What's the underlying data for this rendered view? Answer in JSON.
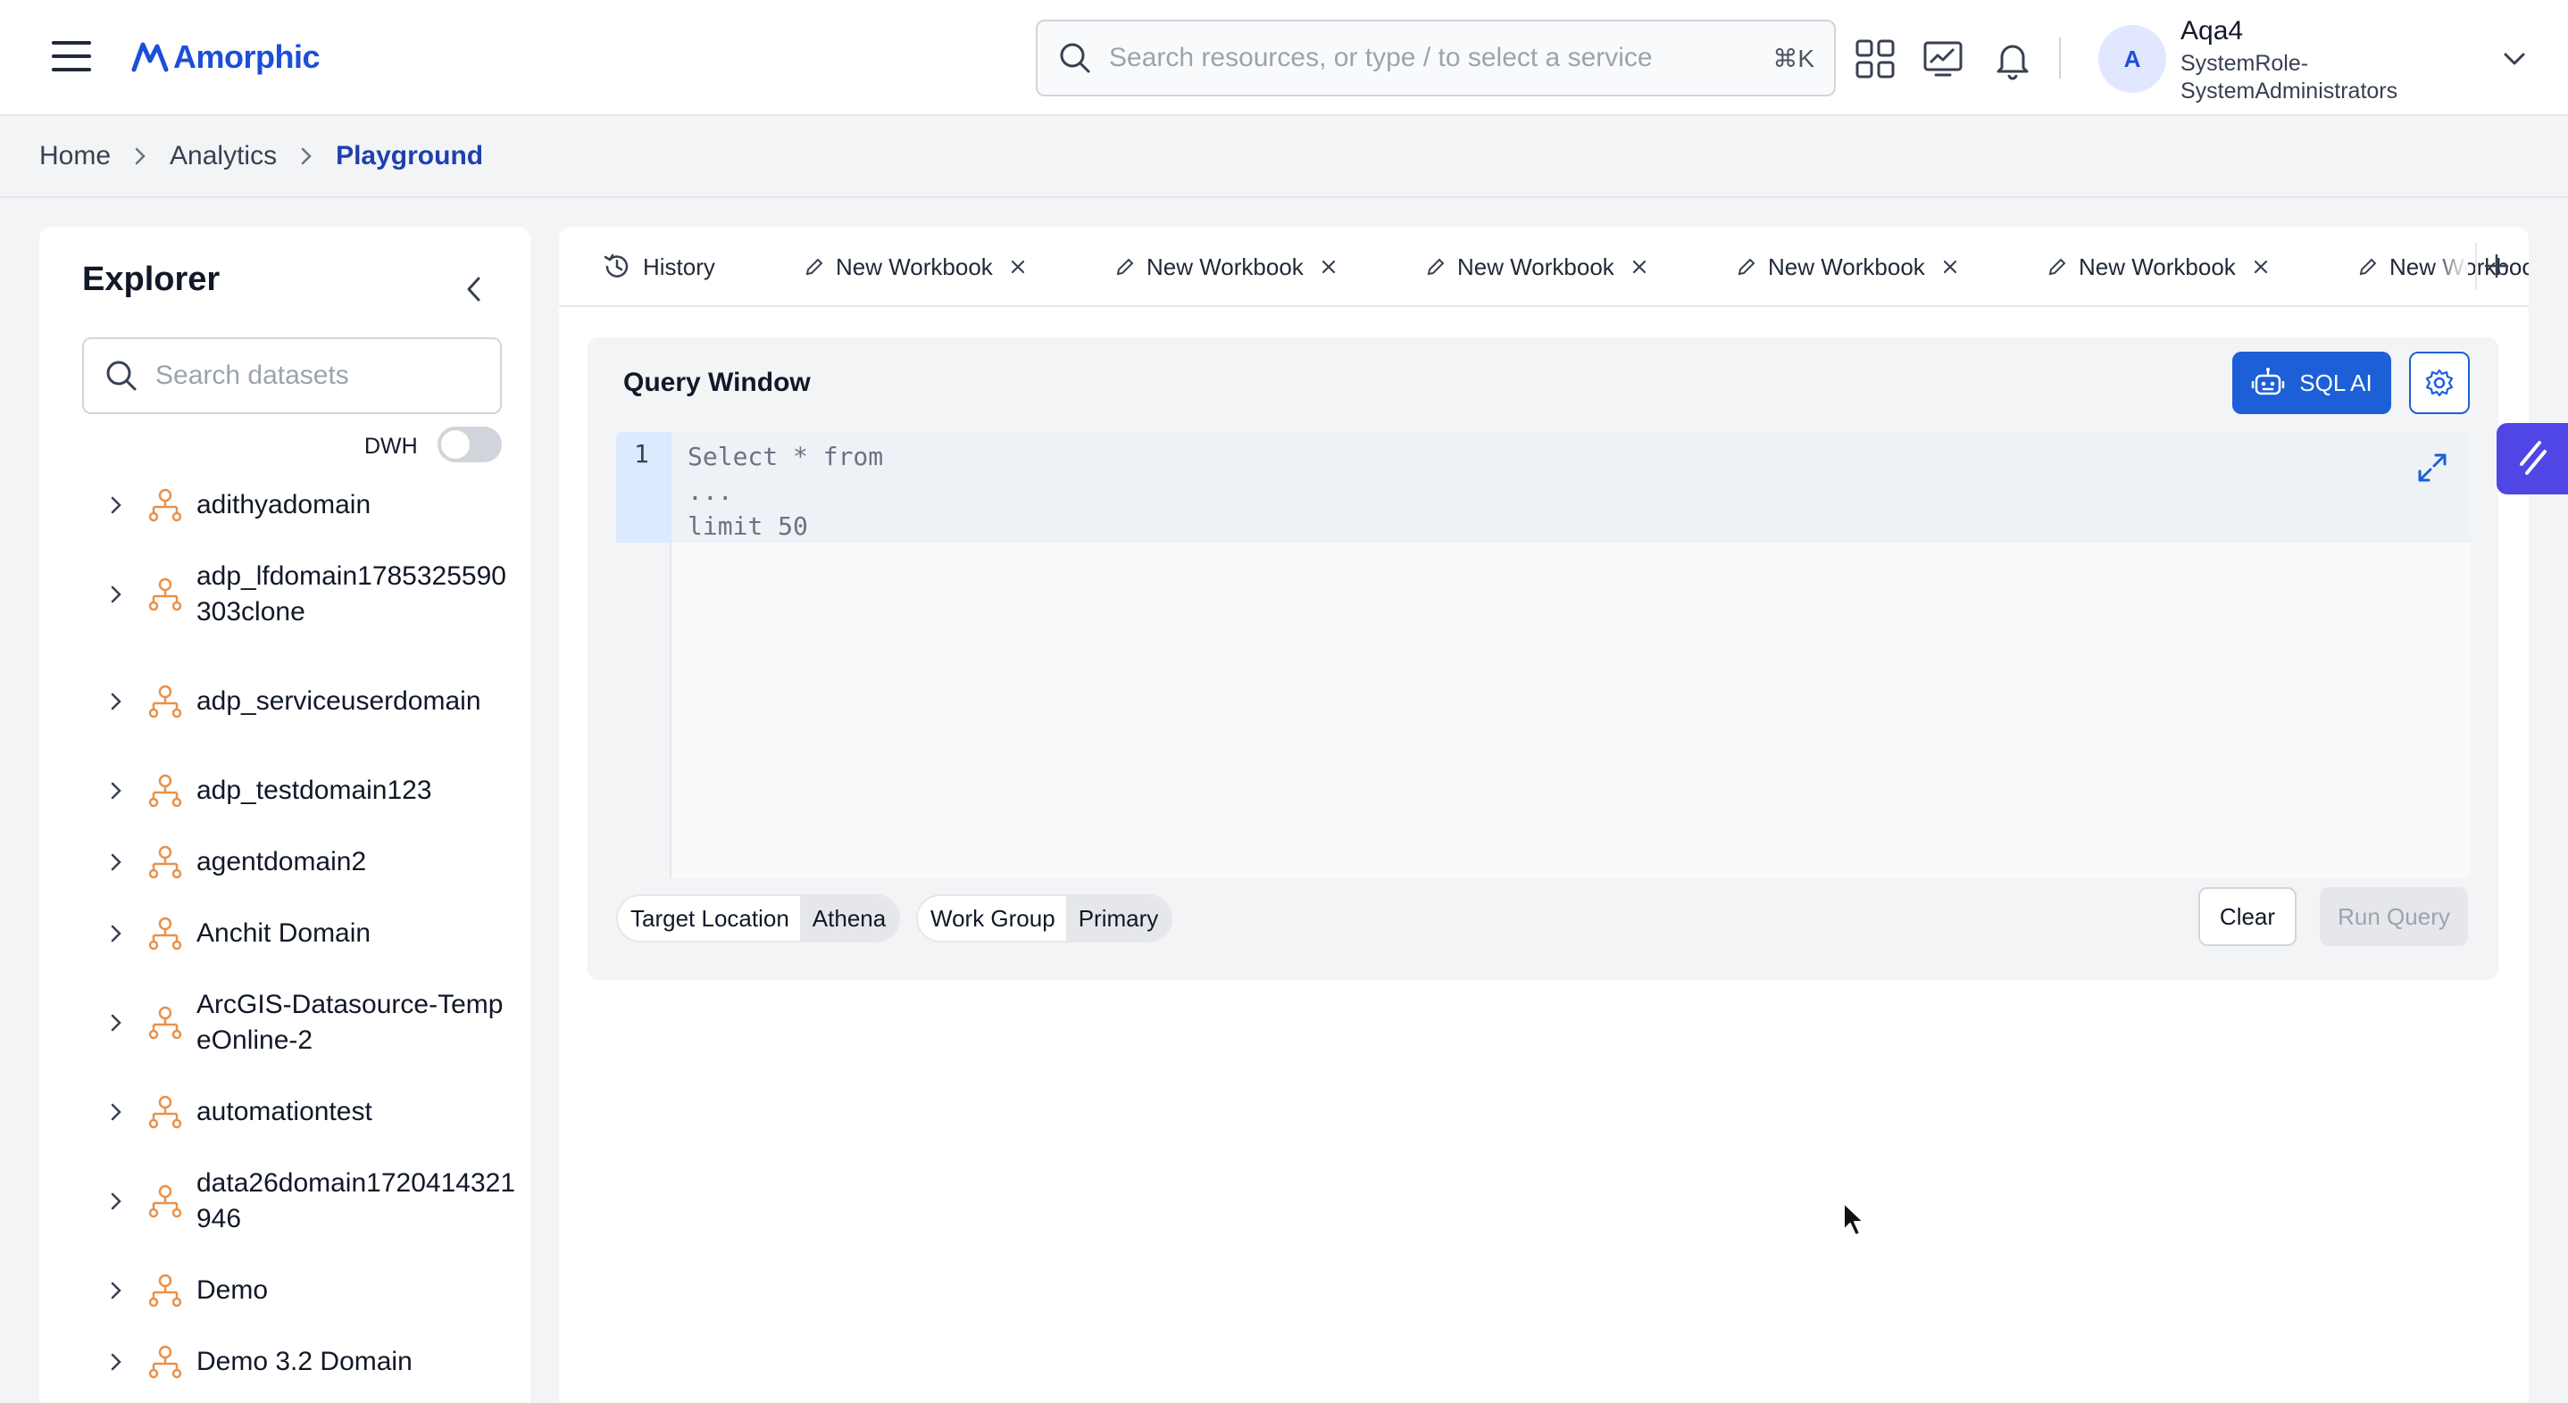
{
  "app": {
    "logo_text": "Amorphic",
    "search_placeholder": "Search resources, or type / to select a service",
    "search_shortcut": "⌘K"
  },
  "user": {
    "avatar_initial": "A",
    "name": "Aqa4",
    "role": "SystemRole-SystemAdministrators"
  },
  "breadcrumb": [
    "Home",
    "Analytics",
    "Playground"
  ],
  "explorer": {
    "title": "Explorer",
    "search_placeholder": "Search datasets",
    "dwh_label": "DWH",
    "dwh_enabled": false,
    "items": [
      {
        "label": "adithyadomain"
      },
      {
        "label": "adp_lfdomain1785325590303clone"
      },
      {
        "label": "adp_serviceuserdomain"
      },
      {
        "label": "adp_testdomain123"
      },
      {
        "label": "agentdomain2"
      },
      {
        "label": "Anchit Domain"
      },
      {
        "label": "ArcGIS-Datasource-TempeOnline-2"
      },
      {
        "label": "automationtest"
      },
      {
        "label": "data26domain1720414321946"
      },
      {
        "label": "Demo"
      },
      {
        "label": "Demo 3.2 Domain"
      }
    ]
  },
  "tabs": {
    "history_label": "History",
    "items": [
      {
        "label": "New Workbook"
      },
      {
        "label": "New Workbook"
      },
      {
        "label": "New Workbook"
      },
      {
        "label": "New Workbook"
      },
      {
        "label": "New Workbook"
      },
      {
        "label": "New Workbook"
      }
    ]
  },
  "query_window": {
    "title": "Query Window",
    "sql_ai_label": "SQL AI",
    "line_number": "1",
    "code": "Select * from\n...\nlimit 50",
    "target_location_label": "Target Location",
    "target_location_value": "Athena",
    "work_group_label": "Work Group",
    "work_group_value": "Primary",
    "clear_label": "Clear",
    "run_label": "Run Query"
  },
  "colors": {
    "brand": "#1d4ed8",
    "primary_button": "#1d5fd6",
    "domain_icon": "#e8914a",
    "assist_tab": "#4f46e5"
  }
}
